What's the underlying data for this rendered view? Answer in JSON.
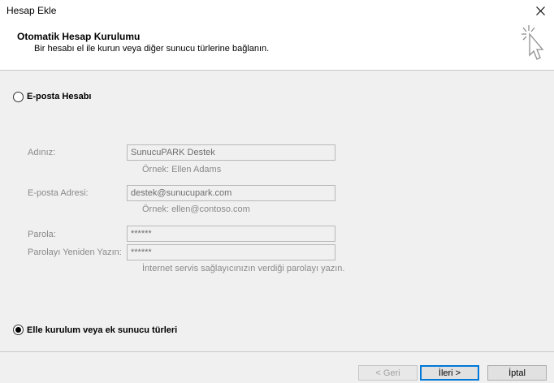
{
  "window": {
    "title": "Hesap Ekle"
  },
  "header": {
    "title": "Otomatik Hesap Kurulumu",
    "subtitle": "Bir hesabı el ile kurun veya diğer sunucu türlerine bağlanın."
  },
  "options": {
    "email_account": {
      "label": "E-posta Hesabı",
      "checked": false
    },
    "manual_setup": {
      "label": "Elle kurulum veya ek sunucu türleri",
      "checked": true
    }
  },
  "form": {
    "name": {
      "label": "Adınız:",
      "value": "SunucuPARK Destek",
      "hint": "Örnek: Ellen Adams"
    },
    "email": {
      "label": "E-posta Adresi:",
      "value": "destek@sunucupark.com",
      "hint": "Örnek: ellen@contoso.com"
    },
    "password": {
      "label": "Parola:",
      "value": "******"
    },
    "password_confirm": {
      "label": "Parolayı Yeniden Yazın:",
      "value": "******",
      "hint": "İnternet servis sağlayıcınızın verdiği parolayı yazın."
    }
  },
  "buttons": {
    "back": "< Geri",
    "next": "İleri >",
    "cancel": "İptal"
  }
}
